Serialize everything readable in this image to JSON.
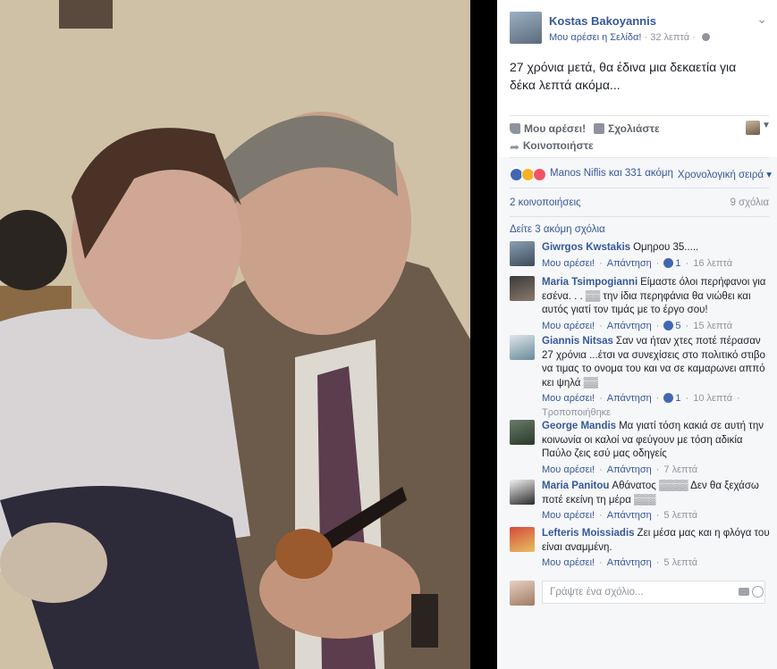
{
  "post": {
    "page_name": "Kostas Bakoyannis",
    "like_page": "Μου αρέσει η Σελίδα!",
    "time": "32 λεπτά",
    "text": "27 χρόνια μετά, θα έδινα μια δεκαετία για δέκα λεπτά ακόμα..."
  },
  "actions": {
    "like": "Μου αρέσει!",
    "comment": "Σχολιάστε",
    "share": "Κοινοποιήστε"
  },
  "reactions": {
    "text": "Manos Niflis και 331 ακόμη",
    "order": "Χρονολογική σειρά",
    "shares": "2 κοινοποιήσεις",
    "comments": "9 σχόλια",
    "more_comments": "Δείτε 3 ακόμη σχόλια"
  },
  "comment_labels": {
    "like": "Μου αρέσει!",
    "reply": "Απάντηση",
    "edited": "Τροποποιήθηκε"
  },
  "comments": [
    {
      "name": "Giwrgos Kwstakis",
      "text": "Ομηρου 35.....",
      "likes": "1",
      "time": "16 λεπτά"
    },
    {
      "name": "Maria Tsimpogianni",
      "text": "Είμαστε όλοι περήφανοι για εσένα. . . ▒▒ την ίδια περηφάνια θα νιώθει και αυτός γιατί τον τιμάς με το έργο σου!",
      "likes": "5",
      "time": "15 λεπτά"
    },
    {
      "name": "Giannis Nitsas",
      "text": "Σαν να ήταν χτες ποτέ πέρασαν 27 χρόνια ...έτσι να συνεχίσεις στο πολιτικό στιβο να τιμας το ονομα του και να σε καμαρωνει αππό κει ψηλά ▒▒",
      "likes": "1",
      "time": "10 λεπτά"
    },
    {
      "name": "George Mandis",
      "text": "Μα γιατί τόση κακιά σε αυτή την κοινωνία οι καλοί να φεύγουν με τόση αδικία Παύλο ζεις εσύ μας οδηγείς",
      "time": "7 λεπτά"
    },
    {
      "name": "Maria Panitou",
      "text": "Αθάνατος ▒▒▒▒ Δεν θα ξεχάσω ποτέ εκείνη τη μέρα ▒▒▒",
      "time": "5 λεπτά"
    },
    {
      "name": "Lefteris Moissiadis",
      "text": "Ζει μέσα μας και η φλόγα του είναι αναμμένη.",
      "time": "5 λεπτά"
    }
  ],
  "write_comment": {
    "placeholder": "Γράψτε ένα σχόλιο..."
  }
}
